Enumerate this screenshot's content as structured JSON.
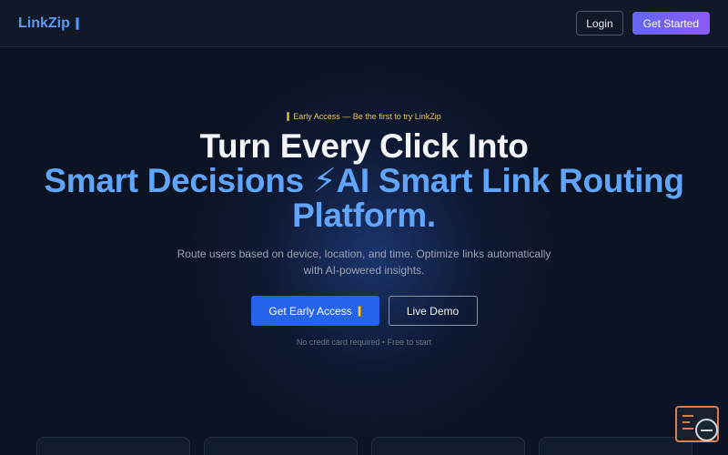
{
  "nav": {
    "logo_text": "LinkZip",
    "login_label": "Login",
    "get_started_label": "Get Started"
  },
  "hero": {
    "badge_text": "Early Access — Be the first to try LinkZip",
    "headline_line1": "Turn Every Click Into",
    "headline_line2": "Smart Decisions ⚡AI Smart Link Routing",
    "headline_line3": "Platform.",
    "subtitle": "Route users based on device, location, and time. Optimize links automatically with AI-powered insights.",
    "primary_cta": "Get Early Access",
    "secondary_cta": "Live Demo",
    "note": "No credit card required • Free to start"
  },
  "colors": {
    "background": "#0c1322",
    "accent_blue": "#60a5fa",
    "primary_button": "#2563eb",
    "badge_yellow": "#e2c15a"
  }
}
